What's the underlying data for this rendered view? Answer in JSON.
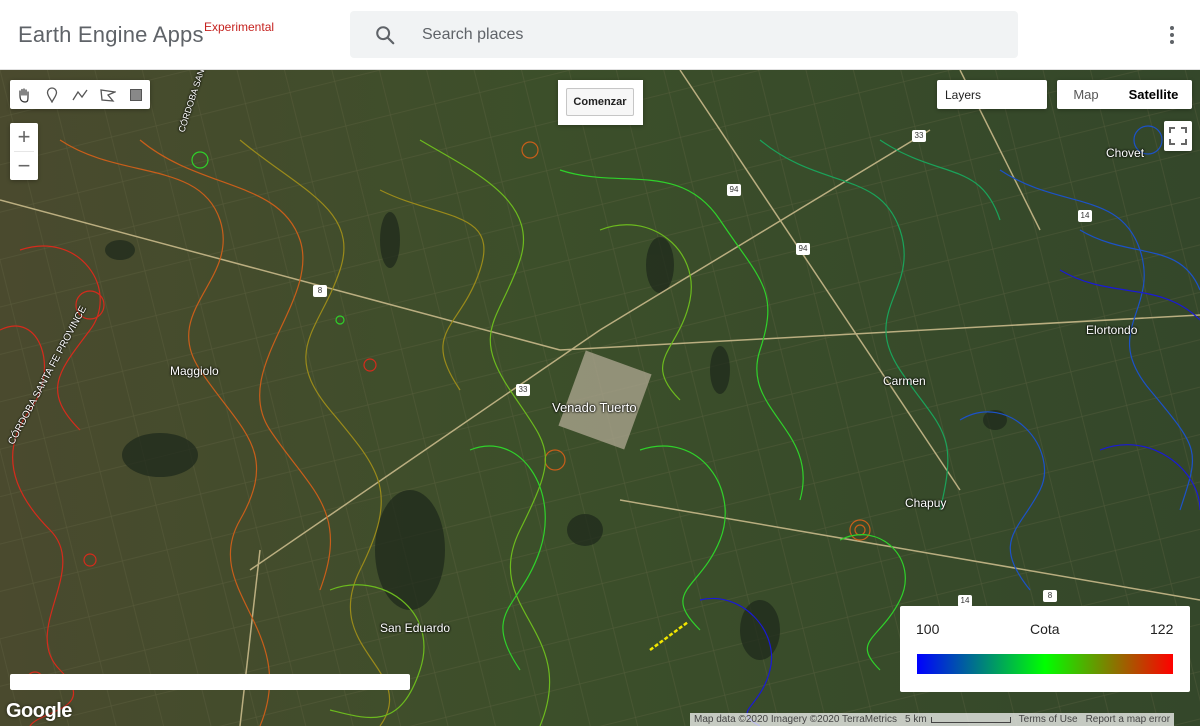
{
  "header": {
    "app_title": "Earth Engine Apps",
    "tag": "Experimental",
    "search_placeholder": "Search places",
    "search_icon": "search-icon",
    "menu_icon": "more-vert-icon"
  },
  "map_controls": {
    "drawing_tools": [
      "hand-pan-icon",
      "marker-icon",
      "polyline-icon",
      "polygon-icon",
      "rectangle-icon"
    ],
    "zoom_in": "+",
    "zoom_out": "−",
    "start_button": "Comenzar",
    "layers_label": "Layers",
    "map_type": {
      "map": "Map",
      "satellite": "Satellite",
      "selected": "Satellite"
    },
    "fullscreen_icon": "fullscreen-icon"
  },
  "places": {
    "venado_tuerto": "Venado Tuerto",
    "maggiolo": "Maggiolo",
    "san_eduardo": "San Eduardo",
    "carmen": "Carmen",
    "chapuy": "Chapuy",
    "elortondo": "Elortondo",
    "chovet": "Chovet",
    "province_border": "CÓRDOBA SANTA FE PROVINCE",
    "province_border_top": "CÓRDOBA SANTA FE"
  },
  "routes": [
    "33",
    "94",
    "8",
    "14",
    "33",
    "94",
    "8",
    "14"
  ],
  "legend": {
    "min": "100",
    "title": "Cota",
    "max": "122",
    "colors": [
      "#0000ff",
      "#00ff00",
      "#ff0000"
    ]
  },
  "footer": {
    "logo": "Google",
    "map_data": "Map data ©2020 Imagery ©2020 TerraMetrics",
    "scale": "5 km",
    "terms": "Terms of Use",
    "report": "Report a map error"
  }
}
